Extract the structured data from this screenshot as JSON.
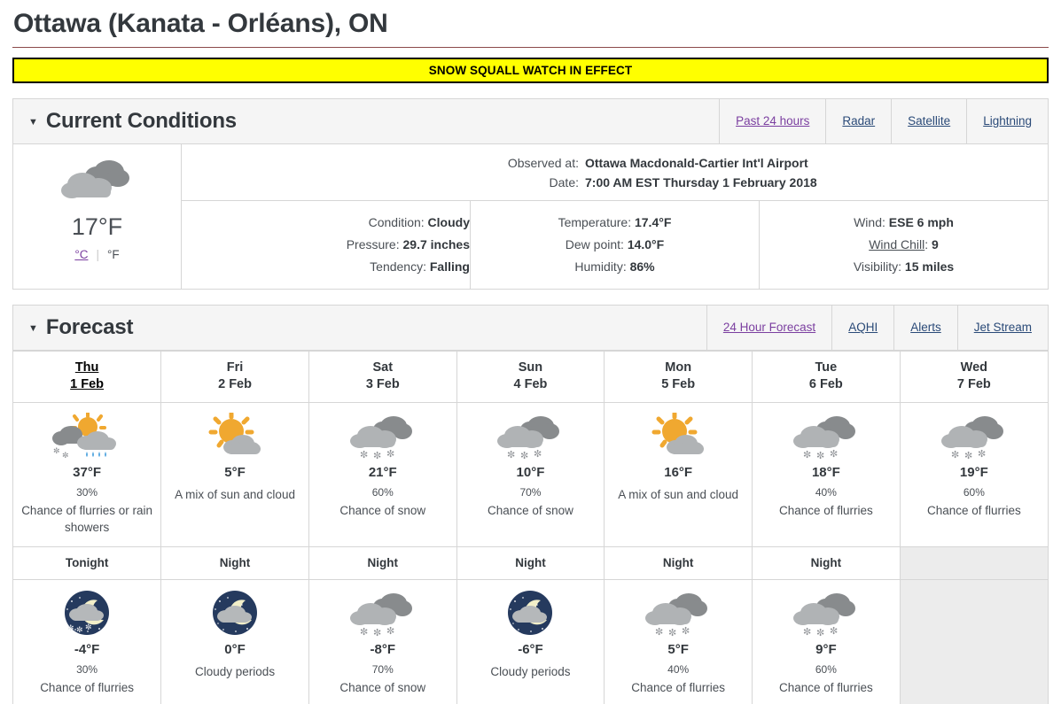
{
  "page": {
    "title": "Ottawa (Kanata - Orléans), ON",
    "alert_banner": "SNOW SQUALL WATCH IN EFFECT",
    "accent_rule_color": "#8b4a4a",
    "alert_bg_color": "#ffff00"
  },
  "current_conditions": {
    "section_title": "Current Conditions",
    "caret": "▼",
    "links": [
      {
        "label": "Past 24 hours",
        "visited": true
      },
      {
        "label": "Radar",
        "visited": false
      },
      {
        "label": "Satellite",
        "visited": false
      },
      {
        "label": "Lightning",
        "visited": false
      }
    ],
    "icon": "cloudy-icon",
    "temperature": "17°F",
    "unit_celsius": "°C",
    "unit_fahrenheit": "°F",
    "unit_separator": "|",
    "observed_at_label": "Observed at:",
    "observed_at_value": "Ottawa Macdonald-Cartier Int'l Airport",
    "date_label": "Date:",
    "date_value": "7:00 AM EST Thursday 1 February 2018",
    "col1": [
      {
        "label": "Condition:",
        "value": "Cloudy"
      },
      {
        "label": "Pressure:",
        "value": "29.7 inches"
      },
      {
        "label": "Tendency:",
        "value": "Falling"
      }
    ],
    "col2": [
      {
        "label": "Temperature:",
        "value": "17.4°F"
      },
      {
        "label": "Dew point:",
        "value": "14.0°F"
      },
      {
        "label": "Humidity:",
        "value": "86%"
      }
    ],
    "col3": [
      {
        "label": "Wind:",
        "value": "ESE 6 mph",
        "link": false
      },
      {
        "label": "Wind Chill",
        "value": "9",
        "link": true
      },
      {
        "label": "Visibility:",
        "value": "15 miles",
        "link": false
      }
    ]
  },
  "forecast": {
    "section_title": "Forecast",
    "caret": "▼",
    "links": [
      {
        "label": "24 Hour Forecast",
        "visited": true
      },
      {
        "label": "AQHI",
        "visited": false
      },
      {
        "label": "Alerts",
        "visited": false
      },
      {
        "label": "Jet Stream",
        "visited": false
      }
    ],
    "days": [
      {
        "weekday": "Thu ",
        "date": "1 Feb",
        "is_link": true
      },
      {
        "weekday": "Fri",
        "date": "2 Feb",
        "is_link": false
      },
      {
        "weekday": "Sat",
        "date": "3 Feb",
        "is_link": false
      },
      {
        "weekday": "Sun",
        "date": "4 Feb",
        "is_link": false
      },
      {
        "weekday": "Mon",
        "date": "5 Feb",
        "is_link": false
      },
      {
        "weekday": "Tue",
        "date": "6 Feb",
        "is_link": false
      },
      {
        "weekday": "Wed",
        "date": "7 Feb",
        "is_link": false
      }
    ],
    "day_cells": [
      {
        "icon": "sun-cloud-snow-rain-icon",
        "temp": "37°F",
        "pop": "30%",
        "summary": "Chance of flurries or rain showers"
      },
      {
        "icon": "sun-cloud-icon",
        "temp": "5°F",
        "pop": "",
        "summary": "A mix of sun and cloud"
      },
      {
        "icon": "cloud-snow-icon",
        "temp": "21°F",
        "pop": "60%",
        "summary": "Chance of snow"
      },
      {
        "icon": "cloud-snow-icon",
        "temp": "10°F",
        "pop": "70%",
        "summary": "Chance of snow"
      },
      {
        "icon": "sun-cloud-icon",
        "temp": "16°F",
        "pop": "",
        "summary": "A mix of sun and cloud"
      },
      {
        "icon": "cloud-snow-icon",
        "temp": "18°F",
        "pop": "40%",
        "summary": "Chance of flurries"
      },
      {
        "icon": "cloud-snow-icon",
        "temp": "19°F",
        "pop": "60%",
        "summary": "Chance of flurries"
      }
    ],
    "night_headers": [
      "Tonight",
      "Night",
      "Night",
      "Night",
      "Night",
      "Night",
      ""
    ],
    "night_cells": [
      {
        "icon": "night-cloud-snow-icon",
        "temp": "-4°F",
        "pop": "30%",
        "summary": "Chance of flurries",
        "empty": false
      },
      {
        "icon": "night-cloudy-icon",
        "temp": "0°F",
        "pop": "",
        "summary": "Cloudy periods",
        "empty": false
      },
      {
        "icon": "cloud-snow-icon",
        "temp": "-8°F",
        "pop": "70%",
        "summary": "Chance of snow",
        "empty": false
      },
      {
        "icon": "night-cloudy-icon",
        "temp": "-6°F",
        "pop": "",
        "summary": "Cloudy periods",
        "empty": false
      },
      {
        "icon": "cloud-snow-icon",
        "temp": "5°F",
        "pop": "40%",
        "summary": "Chance of flurries",
        "empty": false
      },
      {
        "icon": "cloud-snow-icon",
        "temp": "9°F",
        "pop": "60%",
        "summary": "Chance of flurries",
        "empty": false
      },
      {
        "icon": "",
        "temp": "",
        "pop": "",
        "summary": "",
        "empty": true
      }
    ]
  }
}
